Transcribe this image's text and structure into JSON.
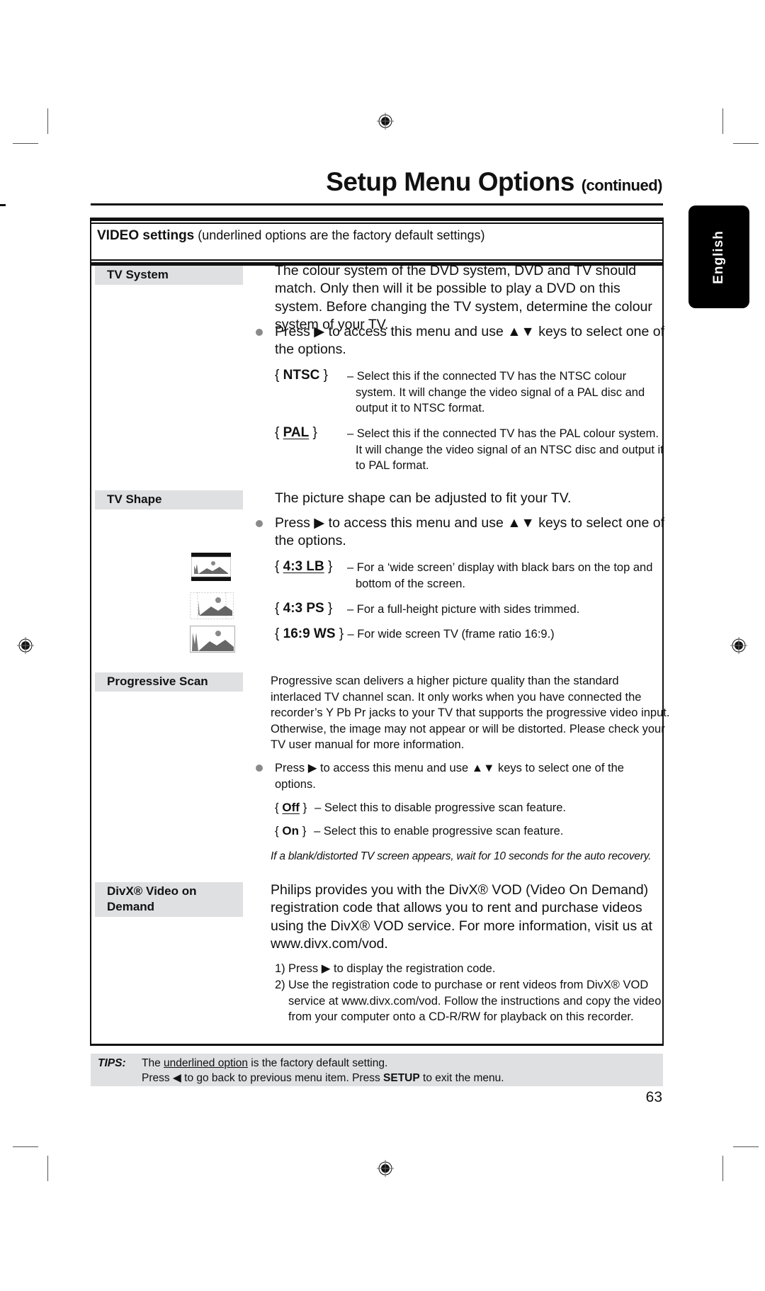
{
  "header": {
    "title": "Setup Menu Options",
    "title_suffix": "(continued)",
    "language_tab": "English"
  },
  "section_header": {
    "bold": "VIDEO settings",
    "note": "(underlined options are the factory default settings)"
  },
  "glyphs": {
    "right_arrow": "▶",
    "left_arrow": "◀",
    "up_down": "▲▼"
  },
  "tv_system": {
    "label": "TV System",
    "description": "The colour system of the DVD system, DVD and TV should match. Only then will it be possible to play a DVD on this system. Before changing the TV system, determine the colour system of your TV.",
    "instruction": "Press ▶ to access this menu and use ▲▼ keys to select one of the options.",
    "options": [
      {
        "name": "NTSC",
        "default": false,
        "description": "– Select this if the connected TV has the NTSC colour system. It will change the video signal of a PAL disc and output it to NTSC format."
      },
      {
        "name": "PAL",
        "default": true,
        "description": "– Select this if the connected TV has the PAL colour system. It will change the video signal of an NTSC disc and output it to PAL format."
      }
    ]
  },
  "tv_shape": {
    "label": "TV Shape",
    "description": "The picture shape can be adjusted to fit your TV.",
    "instruction": "Press ▶ to access this menu and use ▲▼ keys to select one of the options.",
    "options": [
      {
        "name": "4:3 LB",
        "default": true,
        "icon": "letterbox-picture-icon",
        "description": "– For a ‘wide screen’ display with black bars on the top and bottom of the screen."
      },
      {
        "name": "4:3 PS",
        "default": false,
        "icon": "pan-scan-picture-icon",
        "description": "– For a full-height picture with sides trimmed."
      },
      {
        "name": "16:9 WS",
        "default": false,
        "icon": "widescreen-picture-icon",
        "description": "– For wide screen TV (frame ratio 16:9.)"
      }
    ]
  },
  "progressive_scan": {
    "label": "Progressive Scan",
    "description": "Progressive scan delivers a higher picture quality than the standard interlaced TV channel scan. It only works when you have connected the recorder’s Y Pb Pr jacks to your TV that supports the progressive video input. Otherwise, the image may not appear or will be distorted. Please check your TV user manual for more information.",
    "instruction": "Press ▶ to access this menu and use ▲▼ keys to select one of the options.",
    "options": [
      {
        "name": "Off",
        "default": true,
        "description": "– Select this to disable progressive scan feature."
      },
      {
        "name": "On",
        "default": false,
        "description": "– Select this to enable progressive scan feature."
      }
    ],
    "note": "If a blank/distorted TV screen appears, wait for 10 seconds for the auto recovery."
  },
  "divx_vod": {
    "label": "DivX® Video on Demand",
    "description": "Philips provides you with the DivX® VOD (Video On Demand) registration code that allows you to rent and purchase videos using the DivX® VOD service. For more information, visit us at www.divx.com/vod.",
    "steps": [
      {
        "num": "1)",
        "text": "Press ▶ to display the registration code."
      },
      {
        "num": "2)",
        "text": "Use the registration code to purchase or rent videos from DivX® VOD service at www.divx.com/vod. Follow the instructions and copy the video from your computer onto a CD-R/RW for playback on this recorder."
      }
    ]
  },
  "tips": {
    "label": "TIPS:",
    "line1_before": "The ",
    "line1_underlined": "underlined option",
    "line1_after": " is the factory default setting.",
    "line2_before": "Press ◀ to go back to previous menu item. Press ",
    "line2_bold": "SETUP",
    "line2_after": " to exit the menu."
  },
  "page_number": "63",
  "colors": {
    "label_bg": "#dfe0e2",
    "bullet": "#8a8a8a",
    "ink": "#111111"
  }
}
